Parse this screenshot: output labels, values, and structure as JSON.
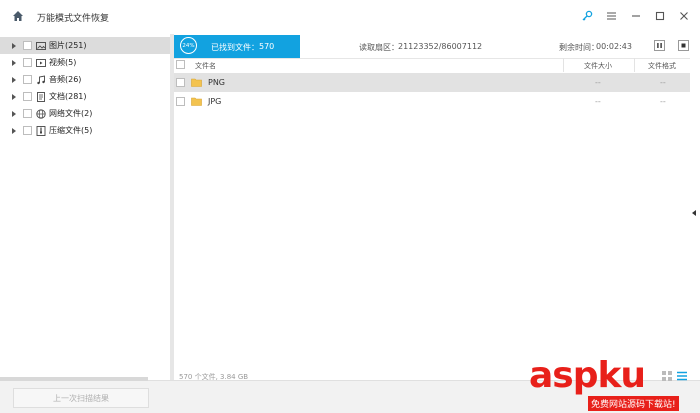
{
  "app": {
    "title": "万能模式文件恢复"
  },
  "sidebar": {
    "items": [
      {
        "label": "图片(251)",
        "icon": "image-icon"
      },
      {
        "label": "视频(5)",
        "icon": "video-icon"
      },
      {
        "label": "音频(26)",
        "icon": "music-icon"
      },
      {
        "label": "文档(281)",
        "icon": "document-icon"
      },
      {
        "label": "网络文件(2)",
        "icon": "globe-icon"
      },
      {
        "label": "压缩文件(5)",
        "icon": "archive-icon"
      }
    ],
    "last_scan_label": "上一次扫描结果"
  },
  "status": {
    "progress_percent": 24,
    "progress_text": "24%",
    "found_label": "已找到文件：",
    "found_count": "570",
    "sector_label": "读取扇区：",
    "sector_value": "21123352/86007112",
    "time_label": "剩余时间：",
    "time_value": "00:02:43"
  },
  "table": {
    "headers": {
      "name": "文件名",
      "size": "文件大小",
      "format": "文件格式"
    },
    "rows": [
      {
        "name": "PNG",
        "size": "--",
        "format": "--"
      },
      {
        "name": "JPG",
        "size": "--",
        "format": "--"
      }
    ]
  },
  "footer": {
    "summary": "570 个文件, 3.84 GB"
  },
  "watermark": {
    "main": "aspku",
    "sub": "免费网站源码下载站!"
  },
  "colors": {
    "accent": "#12a2e0",
    "watermark": "#e8201a"
  }
}
